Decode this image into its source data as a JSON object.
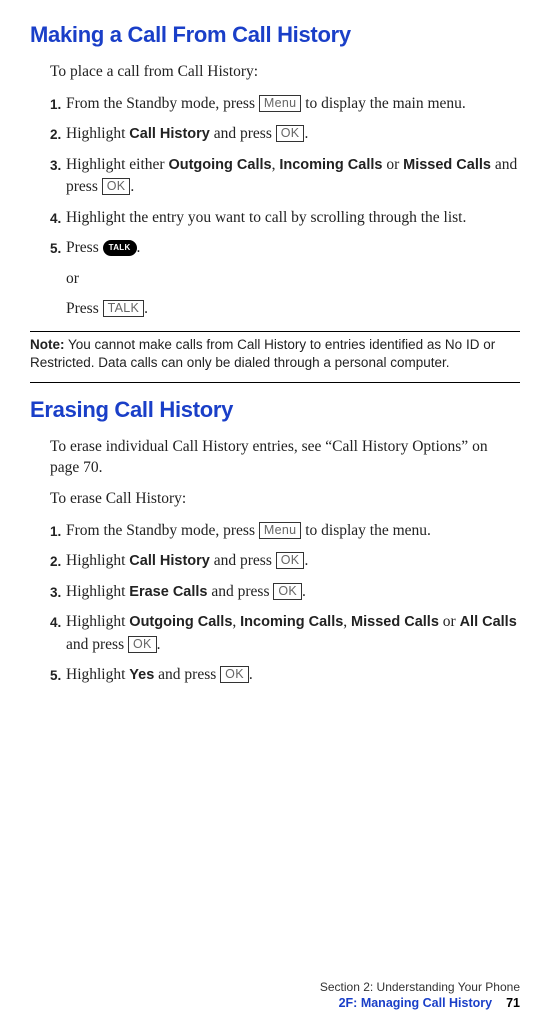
{
  "section1": {
    "title": "Making a Call From Call History",
    "intro": "To place a call from Call History:",
    "steps": {
      "s1": {
        "num": "1.",
        "pre": "From the Standby mode, press ",
        "btn": "Menu",
        "post": " to display the main menu."
      },
      "s2": {
        "num": "2.",
        "pre": "Highlight ",
        "bold": "Call History",
        "mid": " and press ",
        "btn": "OK",
        "post": "."
      },
      "s3": {
        "num": "3.",
        "pre": "Highlight either ",
        "b1": "Outgoing Calls",
        "c1": ", ",
        "b2": "Incoming Calls",
        "c2": " or ",
        "b3": "Missed Calls",
        "post_pre": " and press ",
        "btn": "OK",
        "post": "."
      },
      "s4": {
        "num": "4.",
        "text": "Highlight the entry you want to call by scrolling through the list."
      },
      "s5": {
        "num": "5.",
        "pre": "Press ",
        "pill": "TALK",
        "post": "."
      },
      "sub_or": "or",
      "sub2_pre": "Press ",
      "sub2_btn": "TALK",
      "sub2_post": "."
    }
  },
  "note": {
    "label": "Note:",
    "text": " You cannot make calls from Call History to entries identified as No ID or Restricted. Data calls can only be dialed through a personal computer."
  },
  "section2": {
    "title": "Erasing Call History",
    "intro1": "To erase individual Call History entries, see “Call History Options” on page 70.",
    "intro2": "To erase Call History:",
    "steps": {
      "s1": {
        "num": "1.",
        "pre": "From the Standby mode, press ",
        "btn": "Menu",
        "post": " to display the menu."
      },
      "s2": {
        "num": "2.",
        "pre": "Highlight ",
        "bold": "Call History",
        "mid": " and press ",
        "btn": "OK",
        "post": "."
      },
      "s3": {
        "num": "3.",
        "pre": "Highlight ",
        "bold": "Erase Calls",
        "mid": " and press ",
        "btn": "OK",
        "post": "."
      },
      "s4": {
        "num": "4.",
        "pre": "Highlight ",
        "b1": "Outgoing Calls",
        "c1": ", ",
        "b2": "Incoming Calls",
        "c2": ", ",
        "b3": "Missed Calls",
        "c3": " or ",
        "b4": "All Calls",
        "mid": " and press ",
        "btn": "OK",
        "post": "."
      },
      "s5": {
        "num": "5.",
        "pre": "Highlight ",
        "bold": "Yes",
        "mid": " and press ",
        "btn": "OK",
        "post": "."
      }
    }
  },
  "footer": {
    "line1": "Section 2: Understanding Your Phone",
    "line2": "2F: Managing Call History",
    "page": "71"
  },
  "buttons": {
    "menu": "Menu",
    "ok": "OK",
    "talk": "TALK"
  }
}
